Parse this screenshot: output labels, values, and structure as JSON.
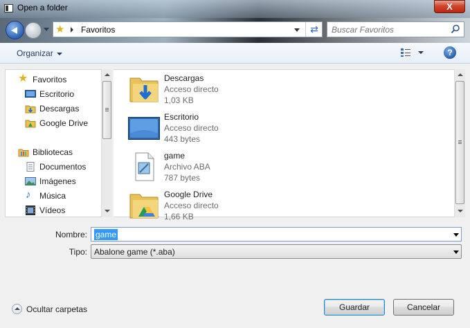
{
  "window": {
    "title": "Open a folder",
    "close_label": "X"
  },
  "navbar": {
    "address": "Favoritos",
    "search_placeholder": "Buscar Favoritos",
    "icons": {
      "back": "back-arrow-icon",
      "forward": "forward-arrow-icon",
      "refresh": "refresh-icon",
      "search": "search-icon"
    }
  },
  "toolbar": {
    "organize_label": "Organizar",
    "help_label": "?"
  },
  "sidebar": {
    "items": [
      {
        "label": "Favoritos",
        "icon": "star-icon"
      },
      {
        "label": "Escritorio",
        "icon": "desktop-icon"
      },
      {
        "label": "Descargas",
        "icon": "downloads-folder-icon"
      },
      {
        "label": "Google Drive",
        "icon": "google-drive-icon"
      },
      {
        "label": "Bibliotecas",
        "icon": "libraries-icon"
      },
      {
        "label": "Documentos",
        "icon": "documents-icon"
      },
      {
        "label": "Imágenes",
        "icon": "pictures-icon"
      },
      {
        "label": "Música",
        "icon": "music-icon"
      },
      {
        "label": "Vídeos",
        "icon": "videos-icon"
      }
    ]
  },
  "files": [
    {
      "name": "Descargas",
      "type": "Acceso directo",
      "size": "1,03 KB"
    },
    {
      "name": "Escritorio",
      "type": "Acceso directo",
      "size": "443 bytes"
    },
    {
      "name": "game",
      "type": "Archivo ABA",
      "size": "787 bytes"
    },
    {
      "name": "Google Drive",
      "type": "Acceso directo",
      "size": "1,66 KB"
    }
  ],
  "form": {
    "name_label": "Nombre:",
    "name_value": "game",
    "type_label": "Tipo:",
    "type_value": "Abalone game (*.aba)"
  },
  "footer": {
    "hide_folders_label": "Ocultar carpetas",
    "save_label": "Guardar",
    "cancel_label": "Cancelar"
  },
  "colors": {
    "selection": "#3399ff",
    "close_button": "#c7391c",
    "link_text": "#1e395b"
  }
}
